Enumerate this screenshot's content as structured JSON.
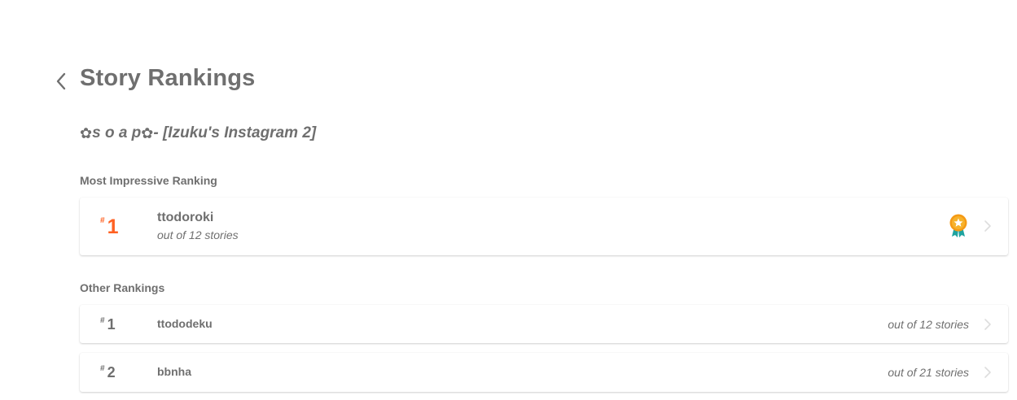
{
  "header": {
    "back_icon": "chevron-left-icon",
    "title": "Story Rankings"
  },
  "story": {
    "prefix_icon": "flower-icon",
    "title_part1": "s o a p",
    "title_part2": " - [Izuku's Instagram 2]"
  },
  "featured": {
    "section_label": "Most Impressive Ranking",
    "hash": "#",
    "rank": "1",
    "tag": "ttodoroki",
    "out_of": "out of 12 stories",
    "badge_icon": "award-ribbon-icon",
    "accent_color": "#ff6122"
  },
  "other": {
    "section_label": "Other Rankings",
    "items": [
      {
        "hash": "#",
        "rank": "1",
        "tag": "ttododeku",
        "out_of": "out of 12 stories"
      },
      {
        "hash": "#",
        "rank": "2",
        "tag": "bbnha",
        "out_of": "out of 21 stories"
      }
    ]
  }
}
